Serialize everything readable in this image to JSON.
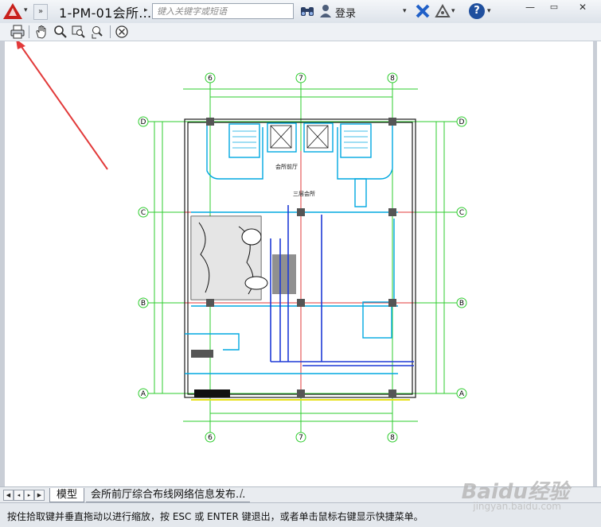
{
  "titlebar": {
    "document_title": "1-PM-01会所...",
    "search_placeholder": "键入关键字或短语",
    "login_label": "登录"
  },
  "tabs": {
    "model": "模型",
    "layout": "会所前厅综合布线网络信息发布...",
    "slash": "/"
  },
  "status": {
    "prompt": "按住拾取键并垂直拖动以进行缩放，按 ESC 或 ENTER 键退出，或者单击鼠标右键显示快捷菜单。"
  },
  "drawing": {
    "grid_top": [
      "6",
      "7",
      "8"
    ],
    "grid_side": [
      "D",
      "C",
      "B",
      "A"
    ],
    "room_labels": [
      "会所前厅",
      "三层会所"
    ]
  },
  "watermark": {
    "brand": "Baidu经验",
    "url": "jingyan.baidu.com"
  },
  "colors": {
    "acad_red": "#c8201c",
    "grid_green": "#2ecc2e",
    "wall_cyan": "#00a8e0",
    "dim_blue": "#1e3ad6",
    "annotation_red": "#e23a3a",
    "edge_yellow": "#e8e11a"
  }
}
